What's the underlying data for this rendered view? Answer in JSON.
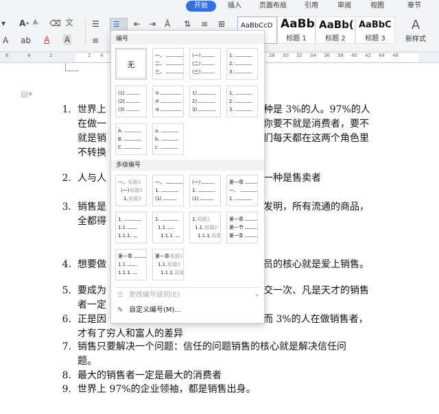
{
  "tabs": [
    {
      "label": "开始",
      "active": true
    },
    {
      "label": "插入",
      "active": false
    },
    {
      "label": "页面布局",
      "active": false
    },
    {
      "label": "引用",
      "active": false
    },
    {
      "label": "审阅",
      "active": false
    },
    {
      "label": "视图",
      "active": false
    },
    {
      "label": "章节",
      "active": false
    }
  ],
  "ribbon": {
    "icons": [
      "font-grow-icon",
      "font-shrink-icon",
      "clear-format-icon",
      "phonetic-icon",
      "bullet-list-icon",
      "numbered-list-icon",
      "decrease-indent-icon",
      "increase-indent-icon",
      "chinese-layout-icon",
      "line-spacing-icon",
      "table-icon",
      "font-color-icon",
      "highlight-icon",
      "char-shading-icon"
    ],
    "styles": [
      {
        "sample": "AaBbCcD",
        "name": "",
        "selected": true
      },
      {
        "sample": "AaBb",
        "name": "标题 1",
        "selected": false
      },
      {
        "sample": "AaBb(",
        "name": "标题 2",
        "selected": false
      },
      {
        "sample": "AaBbC",
        "name": "标题 3",
        "selected": false
      }
    ],
    "new_style_label": "新样式",
    "wen_glyph": "文",
    "accent_color": "#2f6fe8"
  },
  "ruler": {
    "numbers": [
      "6",
      "4",
      "2",
      "2",
      "4",
      "6",
      "8",
      "10",
      "12",
      "14",
      "16",
      "18",
      "20",
      "22",
      "24",
      "26",
      "28",
      "30",
      "32",
      "34",
      "36",
      "38",
      "40",
      "42",
      "44",
      "46"
    ]
  },
  "document": {
    "paragraphs": [
      {
        "num": "1.",
        "lines": [
          "世界上",
          "在做一",
          "就是销",
          "不转换"
        ],
        "right": [
          "种是 3%的人。97%的人",
          "你要不就是消费者，要不",
          "们每天都在这两个角色里",
          ""
        ]
      },
      {
        "num": "2.",
        "lines": [
          "人与人"
        ],
        "right": [
          "一种是售卖者"
        ]
      },
      {
        "num": "3.",
        "lines": [
          "销售是",
          "全都得"
        ],
        "right": [
          "发明，所有流通的商品，",
          ""
        ]
      },
      {
        "num": "4.",
        "lines": [
          "想要做"
        ],
        "right": [
          "员的核心就是爱上销售。"
        ]
      },
      {
        "num": "5.",
        "lines": [
          "要成为",
          "者一定"
        ],
        "right": [
          "交一次、凡是天才的销售",
          ""
        ]
      },
      {
        "num": "6.",
        "lines": [
          "正是因",
          "才有了穷人和富人的差异"
        ],
        "right": [
          "而 3%的人在做销售者，",
          ""
        ]
      },
      {
        "num": "7.",
        "lines": [
          "销售只要解决一个问题：信任的问题销售的核心就是解决信任问",
          "题。"
        ],
        "right": [
          "",
          ""
        ]
      },
      {
        "num": "8.",
        "lines": [
          "最大的销售者一定是最大的消费者"
        ],
        "right": [
          ""
        ]
      },
      {
        "num": "9.",
        "lines": [
          "世界上 97%的企业领袖，都是销售出身。"
        ],
        "right": [
          ""
        ]
      }
    ]
  },
  "dropdown": {
    "section_numbering": "编号",
    "section_multilevel": "多级编号",
    "none_label": "无",
    "single": [
      {
        "lines": [
          {
            "m": "一、"
          },
          {
            "m": "二、"
          },
          {
            "m": "三、"
          }
        ]
      },
      {
        "lines": [
          {
            "m": "(一)"
          },
          {
            "m": "(二)"
          },
          {
            "m": "(三)"
          }
        ]
      },
      {
        "lines": [
          {
            "m": "1."
          },
          {
            "m": "2."
          },
          {
            "m": "3."
          }
        ]
      },
      {
        "lines": [
          {
            "m": "(1)"
          },
          {
            "m": "(2)"
          },
          {
            "m": "(3)"
          }
        ]
      },
      {
        "lines": [
          {
            "m": "①"
          },
          {
            "m": "②"
          },
          {
            "m": "③"
          }
        ]
      },
      {
        "lines": [
          {
            "m": "1)"
          },
          {
            "m": "2)"
          },
          {
            "m": "3)"
          }
        ]
      },
      {
        "lines": [
          {
            "m": "1."
          },
          {
            "m": "2."
          },
          {
            "m": "3."
          }
        ]
      },
      {
        "lines": [
          {
            "m": "A."
          },
          {
            "m": "B."
          },
          {
            "m": "C."
          }
        ]
      },
      {
        "lines": [
          {
            "m": "a."
          },
          {
            "m": "b."
          },
          {
            "m": "c."
          }
        ]
      }
    ],
    "multi": [
      {
        "lines": [
          {
            "m": "一、",
            "g": "标题1"
          },
          {
            "m": "(一)",
            "g": "标题2"
          },
          {
            "m": "1.",
            "g": "标题3"
          }
        ]
      },
      {
        "lines": [
          {
            "m": "一、"
          },
          {
            "m": "1."
          },
          {
            "m": "(1)"
          }
        ]
      },
      {
        "lines": [
          {
            "m": "(一)"
          },
          {
            "m": "1."
          },
          {
            "m": "(1)"
          }
        ]
      },
      {
        "lines": [
          {
            "m": "第一章"
          },
          {
            "m": "一、"
          },
          {
            "m": "1."
          }
        ]
      },
      {
        "lines": [
          {
            "m": "1."
          },
          {
            "m": "1.1."
          },
          {
            "m": "1.1.1."
          }
        ]
      },
      {
        "lines": [
          {
            "m": "1."
          },
          {
            "m": "1.1."
          },
          {
            "m": "1.1.1."
          }
        ]
      },
      {
        "lines": [
          {
            "m": "1.",
            "g": "标题1"
          },
          {
            "m": "1.1.",
            "g": "标题2"
          },
          {
            "m": "1.1.1.",
            "g": "标题3"
          }
        ]
      },
      {
        "lines": [
          {
            "m": "第一章"
          },
          {
            "m": "第一节"
          },
          {
            "m": "第一条"
          }
        ]
      },
      {
        "lines": [
          {
            "m": "第一章"
          },
          {
            "m": "1.1."
          },
          {
            "m": "1.1.1."
          }
        ]
      },
      {
        "lines": [
          {
            "m": "第一章",
            "g": "标题1"
          },
          {
            "m": "1.1.",
            "g": "标题2"
          },
          {
            "m": "1.1.1.",
            "g": "标题3"
          }
        ]
      }
    ],
    "change_level": "更改编号级别(E)",
    "custom": "自定义编号(M)..."
  }
}
